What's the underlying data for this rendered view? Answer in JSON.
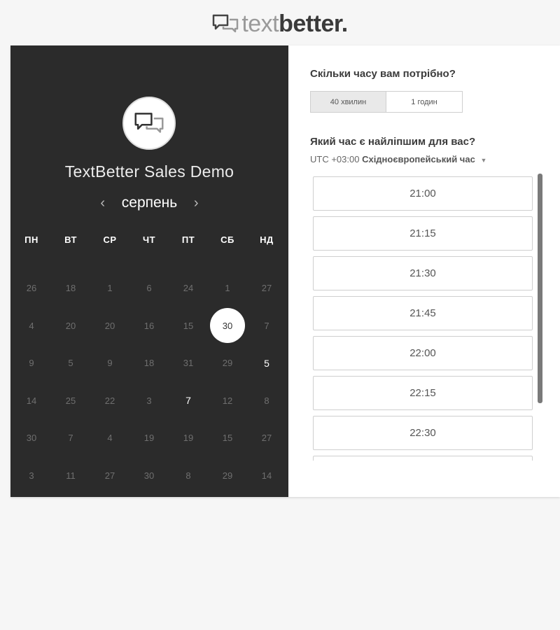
{
  "logo": {
    "part1": "text",
    "part2": "better."
  },
  "left_panel": {
    "title": "TextBetter Sales Demo",
    "month": "серпень",
    "prev_arrow": "‹",
    "next_arrow": "›",
    "weekdays": [
      "ПН",
      "ВТ",
      "СР",
      "ЧТ",
      "ПТ",
      "СБ",
      "НД"
    ],
    "weeks": [
      [
        "26",
        "18",
        "1",
        "6",
        "24",
        "1",
        "27"
      ],
      [
        "4",
        "20",
        "20",
        "16",
        "15",
        "30",
        "7"
      ],
      [
        "9",
        "5",
        "9",
        "18",
        "31",
        "29",
        "5"
      ],
      [
        "14",
        "25",
        "22",
        "3",
        "7",
        "12",
        "8"
      ],
      [
        "30",
        "7",
        "4",
        "19",
        "19",
        "15",
        "27"
      ],
      [
        "3",
        "11",
        "27",
        "30",
        "8",
        "29",
        "14"
      ]
    ],
    "selected_day": "30",
    "available_days": [
      "5",
      "7"
    ]
  },
  "right_panel": {
    "duration_question": "Скільки часу вам потрібно?",
    "duration_options": [
      "40 хвилин",
      "1 годин"
    ],
    "selected_duration": "40 хвилин",
    "time_question": "Який час є найліпшим для вас?",
    "timezone_offset": "UTC +03:00",
    "timezone_name": "Східноєвропейський час",
    "time_slots": [
      "21:00",
      "21:15",
      "21:30",
      "21:45",
      "22:00",
      "22:15",
      "22:30",
      ""
    ]
  },
  "colors": {
    "left_bg": "#2b2b2b",
    "accent": "#ffffff"
  }
}
